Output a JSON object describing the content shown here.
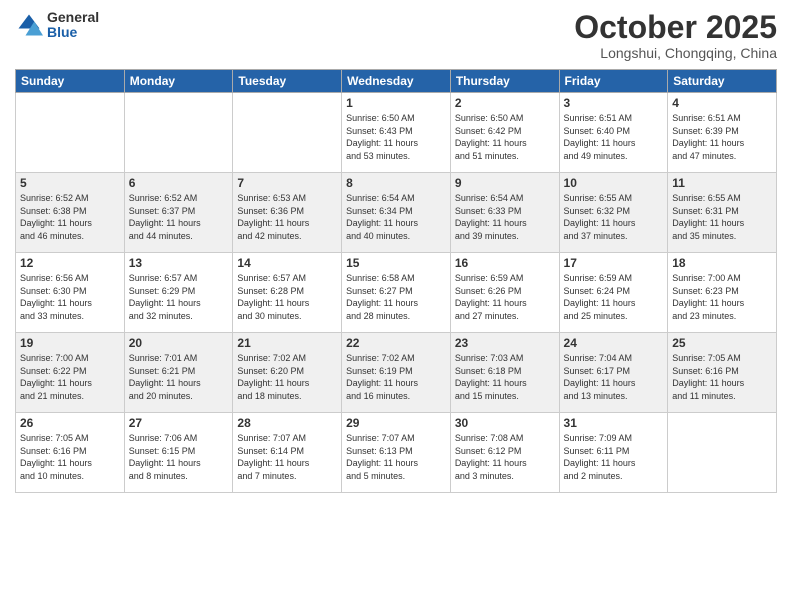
{
  "logo": {
    "general": "General",
    "blue": "Blue"
  },
  "title": "October 2025",
  "subtitle": "Longshui, Chongqing, China",
  "days_of_week": [
    "Sunday",
    "Monday",
    "Tuesday",
    "Wednesday",
    "Thursday",
    "Friday",
    "Saturday"
  ],
  "weeks": [
    [
      {
        "day": "",
        "info": ""
      },
      {
        "day": "",
        "info": ""
      },
      {
        "day": "",
        "info": ""
      },
      {
        "day": "1",
        "info": "Sunrise: 6:50 AM\nSunset: 6:43 PM\nDaylight: 11 hours\nand 53 minutes."
      },
      {
        "day": "2",
        "info": "Sunrise: 6:50 AM\nSunset: 6:42 PM\nDaylight: 11 hours\nand 51 minutes."
      },
      {
        "day": "3",
        "info": "Sunrise: 6:51 AM\nSunset: 6:40 PM\nDaylight: 11 hours\nand 49 minutes."
      },
      {
        "day": "4",
        "info": "Sunrise: 6:51 AM\nSunset: 6:39 PM\nDaylight: 11 hours\nand 47 minutes."
      }
    ],
    [
      {
        "day": "5",
        "info": "Sunrise: 6:52 AM\nSunset: 6:38 PM\nDaylight: 11 hours\nand 46 minutes."
      },
      {
        "day": "6",
        "info": "Sunrise: 6:52 AM\nSunset: 6:37 PM\nDaylight: 11 hours\nand 44 minutes."
      },
      {
        "day": "7",
        "info": "Sunrise: 6:53 AM\nSunset: 6:36 PM\nDaylight: 11 hours\nand 42 minutes."
      },
      {
        "day": "8",
        "info": "Sunrise: 6:54 AM\nSunset: 6:34 PM\nDaylight: 11 hours\nand 40 minutes."
      },
      {
        "day": "9",
        "info": "Sunrise: 6:54 AM\nSunset: 6:33 PM\nDaylight: 11 hours\nand 39 minutes."
      },
      {
        "day": "10",
        "info": "Sunrise: 6:55 AM\nSunset: 6:32 PM\nDaylight: 11 hours\nand 37 minutes."
      },
      {
        "day": "11",
        "info": "Sunrise: 6:55 AM\nSunset: 6:31 PM\nDaylight: 11 hours\nand 35 minutes."
      }
    ],
    [
      {
        "day": "12",
        "info": "Sunrise: 6:56 AM\nSunset: 6:30 PM\nDaylight: 11 hours\nand 33 minutes."
      },
      {
        "day": "13",
        "info": "Sunrise: 6:57 AM\nSunset: 6:29 PM\nDaylight: 11 hours\nand 32 minutes."
      },
      {
        "day": "14",
        "info": "Sunrise: 6:57 AM\nSunset: 6:28 PM\nDaylight: 11 hours\nand 30 minutes."
      },
      {
        "day": "15",
        "info": "Sunrise: 6:58 AM\nSunset: 6:27 PM\nDaylight: 11 hours\nand 28 minutes."
      },
      {
        "day": "16",
        "info": "Sunrise: 6:59 AM\nSunset: 6:26 PM\nDaylight: 11 hours\nand 27 minutes."
      },
      {
        "day": "17",
        "info": "Sunrise: 6:59 AM\nSunset: 6:24 PM\nDaylight: 11 hours\nand 25 minutes."
      },
      {
        "day": "18",
        "info": "Sunrise: 7:00 AM\nSunset: 6:23 PM\nDaylight: 11 hours\nand 23 minutes."
      }
    ],
    [
      {
        "day": "19",
        "info": "Sunrise: 7:00 AM\nSunset: 6:22 PM\nDaylight: 11 hours\nand 21 minutes."
      },
      {
        "day": "20",
        "info": "Sunrise: 7:01 AM\nSunset: 6:21 PM\nDaylight: 11 hours\nand 20 minutes."
      },
      {
        "day": "21",
        "info": "Sunrise: 7:02 AM\nSunset: 6:20 PM\nDaylight: 11 hours\nand 18 minutes."
      },
      {
        "day": "22",
        "info": "Sunrise: 7:02 AM\nSunset: 6:19 PM\nDaylight: 11 hours\nand 16 minutes."
      },
      {
        "day": "23",
        "info": "Sunrise: 7:03 AM\nSunset: 6:18 PM\nDaylight: 11 hours\nand 15 minutes."
      },
      {
        "day": "24",
        "info": "Sunrise: 7:04 AM\nSunset: 6:17 PM\nDaylight: 11 hours\nand 13 minutes."
      },
      {
        "day": "25",
        "info": "Sunrise: 7:05 AM\nSunset: 6:16 PM\nDaylight: 11 hours\nand 11 minutes."
      }
    ],
    [
      {
        "day": "26",
        "info": "Sunrise: 7:05 AM\nSunset: 6:16 PM\nDaylight: 11 hours\nand 10 minutes."
      },
      {
        "day": "27",
        "info": "Sunrise: 7:06 AM\nSunset: 6:15 PM\nDaylight: 11 hours\nand 8 minutes."
      },
      {
        "day": "28",
        "info": "Sunrise: 7:07 AM\nSunset: 6:14 PM\nDaylight: 11 hours\nand 7 minutes."
      },
      {
        "day": "29",
        "info": "Sunrise: 7:07 AM\nSunset: 6:13 PM\nDaylight: 11 hours\nand 5 minutes."
      },
      {
        "day": "30",
        "info": "Sunrise: 7:08 AM\nSunset: 6:12 PM\nDaylight: 11 hours\nand 3 minutes."
      },
      {
        "day": "31",
        "info": "Sunrise: 7:09 AM\nSunset: 6:11 PM\nDaylight: 11 hours\nand 2 minutes."
      },
      {
        "day": "",
        "info": ""
      }
    ]
  ]
}
